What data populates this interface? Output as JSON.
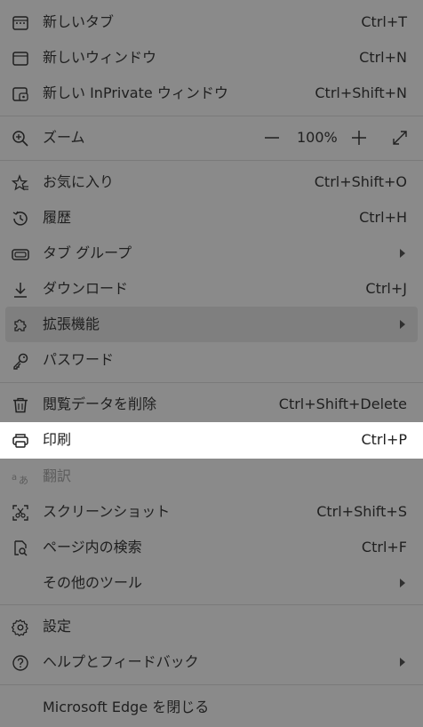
{
  "menu": {
    "new_tab": {
      "label": "新しいタブ",
      "shortcut": "Ctrl+T"
    },
    "new_window": {
      "label": "新しいウィンドウ",
      "shortcut": "Ctrl+N"
    },
    "new_inprivate": {
      "label": "新しい InPrivate ウィンドウ",
      "shortcut": "Ctrl+Shift+N"
    },
    "zoom": {
      "label": "ズーム",
      "minus": "—",
      "value": "100%",
      "plus": "+"
    },
    "favorites": {
      "label": "お気に入り",
      "shortcut": "Ctrl+Shift+O"
    },
    "history": {
      "label": "履歴",
      "shortcut": "Ctrl+H"
    },
    "tab_groups": {
      "label": "タブ グループ"
    },
    "downloads": {
      "label": "ダウンロード",
      "shortcut": "Ctrl+J"
    },
    "extensions": {
      "label": "拡張機能"
    },
    "passwords": {
      "label": "パスワード"
    },
    "clear_data": {
      "label": "閲覧データを削除",
      "shortcut": "Ctrl+Shift+Delete"
    },
    "print": {
      "label": "印刷",
      "shortcut": "Ctrl+P"
    },
    "translate": {
      "label": "翻訳"
    },
    "screenshot": {
      "label": "スクリーンショット",
      "shortcut": "Ctrl+Shift+S"
    },
    "find": {
      "label": "ページ内の検索",
      "shortcut": "Ctrl+F"
    },
    "more_tools": {
      "label": "その他のツール"
    },
    "settings": {
      "label": "設定"
    },
    "help": {
      "label": "ヘルプとフィードバック"
    },
    "close": {
      "label": "Microsoft Edge を閉じる"
    }
  },
  "colors": {
    "overlay": "#8a8a8a",
    "selected": "#ffffff",
    "hover": "#7f7f7f",
    "text": "#202020"
  }
}
